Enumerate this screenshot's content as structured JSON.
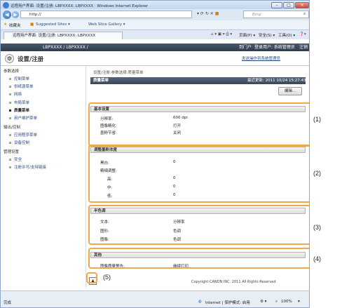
{
  "window": {
    "title": "远程用户界面: 设置/注册: LBPXXXX: LBPXXXX · Windows Internet Explorer"
  },
  "browser": {
    "url": "http://",
    "search_placeholder": "Bing",
    "favorites_label": "收藏夹",
    "fav_links": [
      "Suggested Sites ▾",
      "Web Slice Gallery ▾"
    ],
    "tab_title": "远程用户界面: 设置/注册: LBPXXXX: LBPXXXX",
    "tools": [
      "页面(P) ▾",
      "安全(S) ▾",
      "工具(O) ▾"
    ],
    "status_left": "完成",
    "status_zone": "Internet | 保护模式: 启用",
    "zoom": "100%"
  },
  "rui": {
    "device_name": "LBPXXXX / LBPXXXX /",
    "top_links": [
      "到门户",
      "登录用户: 系统管理员",
      "注销"
    ],
    "page_heading": "设置/注册",
    "mail_link": "发送操作到系统管理员",
    "breadcrumb": "设置/注册:参数选择:质量菜单",
    "panel_title": "质量菜单",
    "last_updated": "最近更新: 2011 10/24 15:27:43",
    "edit_button": "编辑...",
    "copyright": "Copyright CANON INC. 2011 All Rights Reserved"
  },
  "sidebar": {
    "group1": "参数选择",
    "group1_items": [
      "控制菜单",
      "供纸源菜单",
      "网络",
      "布局菜单",
      "质量菜单",
      "用户维护菜单"
    ],
    "group2": "输出/控制",
    "group2_items": [
      "应用程序菜单",
      "设备控制"
    ],
    "group3": "管理设置",
    "group3_items": [
      "安全",
      "注册许可/支持链接"
    ],
    "active_index": 4
  },
  "sections": {
    "basic": {
      "title": "基本设置",
      "rows": [
        {
          "label": "分辨率:",
          "value": "600 dpi"
        },
        {
          "label": "图像精化:",
          "value": "打开"
        },
        {
          "label": "墨粉节省:",
          "value": "关闭"
        }
      ]
    },
    "density": {
      "title": "调整墨粉浓度",
      "rows": [
        {
          "label": "黑白:",
          "value": "0"
        },
        {
          "label": "精细调整:",
          "value": ""
        },
        {
          "label": "高:",
          "value": "0"
        },
        {
          "label": "中:",
          "value": "0"
        },
        {
          "label": "低:",
          "value": "0"
        }
      ]
    },
    "halftone": {
      "title": "半色调",
      "rows": [
        {
          "label": "文本:",
          "value": "分辨率"
        },
        {
          "label": "图形:",
          "value": "色调"
        },
        {
          "label": "图像:",
          "value": "色调"
        }
      ]
    },
    "other": {
      "title": "其他",
      "rows": [
        {
          "label": "图像质量警告:",
          "value": "继续打印"
        }
      ]
    }
  },
  "callouts": [
    "(1)",
    "(2)",
    "(3)",
    "(4)",
    "(5)"
  ]
}
